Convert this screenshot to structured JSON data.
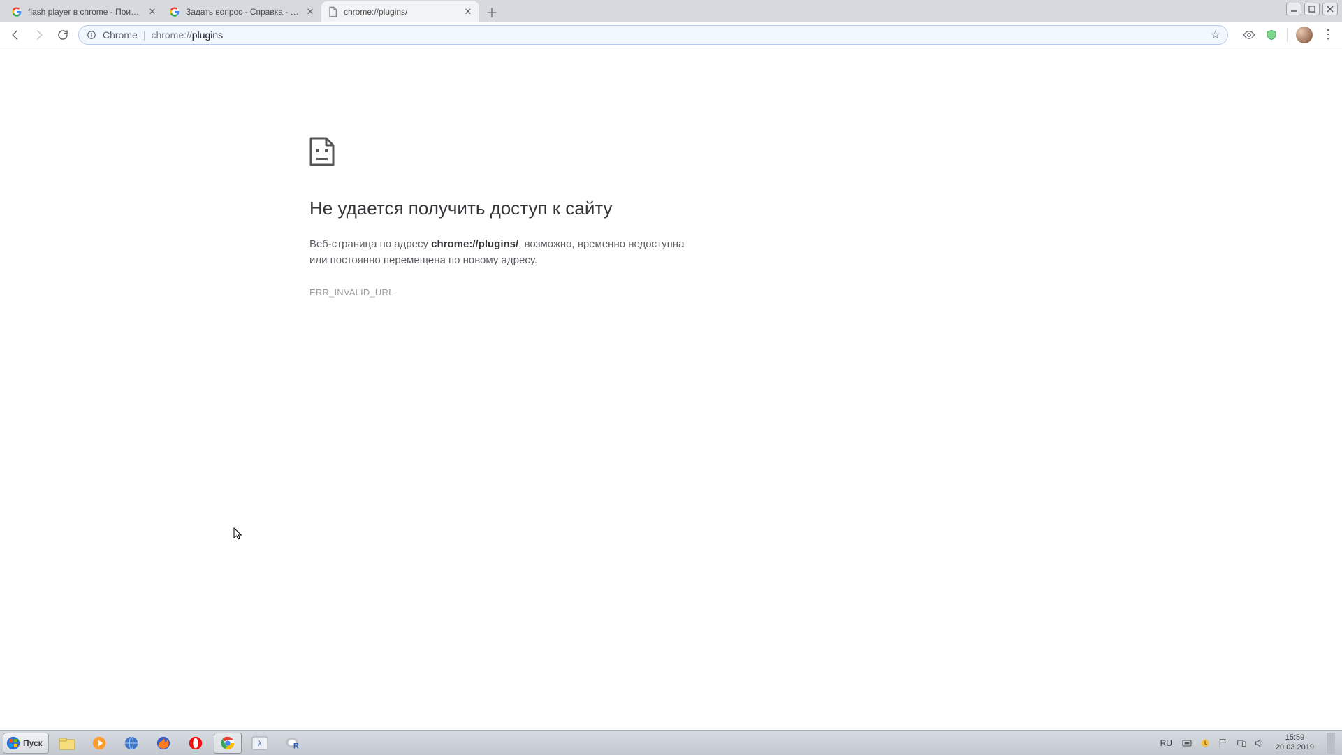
{
  "tabs": [
    {
      "title": "flash player в chrome - Поиск в Go",
      "favicon": "google"
    },
    {
      "title": "Задать вопрос - Справка - Google",
      "favicon": "google"
    },
    {
      "title": "chrome://plugins/",
      "favicon": "doc"
    }
  ],
  "active_tab_index": 2,
  "omnibox": {
    "chip": "Chrome",
    "url_dim1": "chrome://",
    "url_strong": "plugins"
  },
  "error": {
    "title": "Не удается получить доступ к сайту",
    "pre": "Веб-страница по адресу ",
    "url": "chrome://plugins/",
    "post": ", возможно, временно недоступна или постоянно перемещена по новому адресу.",
    "code": "ERR_INVALID_URL"
  },
  "taskbar": {
    "start_label": "Пуск",
    "lang": "RU",
    "time": "15:59",
    "date": "20.03.2019"
  }
}
